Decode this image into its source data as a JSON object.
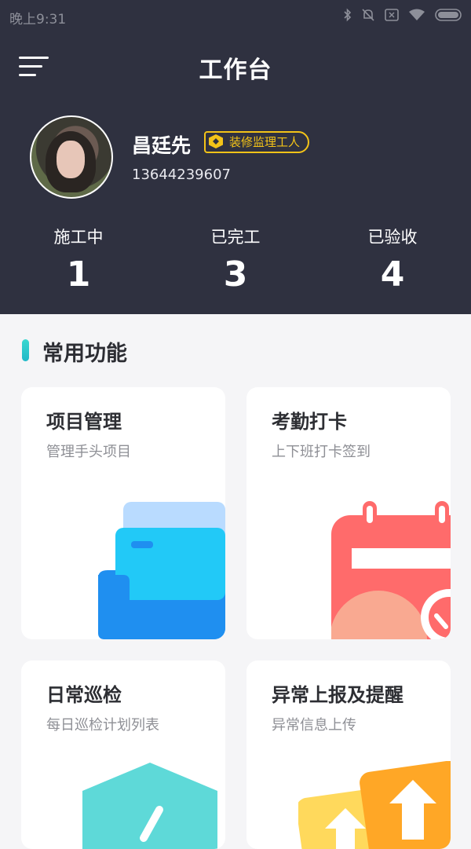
{
  "status_bar": {
    "time": "晚上9:31",
    "icons": [
      "bluetooth-icon",
      "mute-icon",
      "sim-icon",
      "wifi-icon",
      "battery-icon"
    ]
  },
  "header": {
    "title": "工作台",
    "menu_icon": "menu-icon",
    "user": {
      "name": "昌廷先",
      "role": "装修监理工人",
      "phone": "13644239607"
    },
    "stats": [
      {
        "label": "施工中",
        "value": "1"
      },
      {
        "label": "已完工",
        "value": "3"
      },
      {
        "label": "已验收",
        "value": "4"
      }
    ]
  },
  "section": {
    "title": "常用功能"
  },
  "cards": [
    {
      "title": "项目管理",
      "subtitle": "管理手头项目",
      "icon": "folder-icon"
    },
    {
      "title": "考勤打卡",
      "subtitle": "上下班打卡签到",
      "icon": "calendar-icon"
    },
    {
      "title": "日常巡检",
      "subtitle": "每日巡检计划列表",
      "icon": "inspection-icon"
    },
    {
      "title": "异常上报及提醒",
      "subtitle": "异常信息上传",
      "icon": "upload-icon"
    }
  ],
  "colors": {
    "header_bg": "#2f3140",
    "badge": "#f3c318",
    "accent": "#38d8d0"
  }
}
